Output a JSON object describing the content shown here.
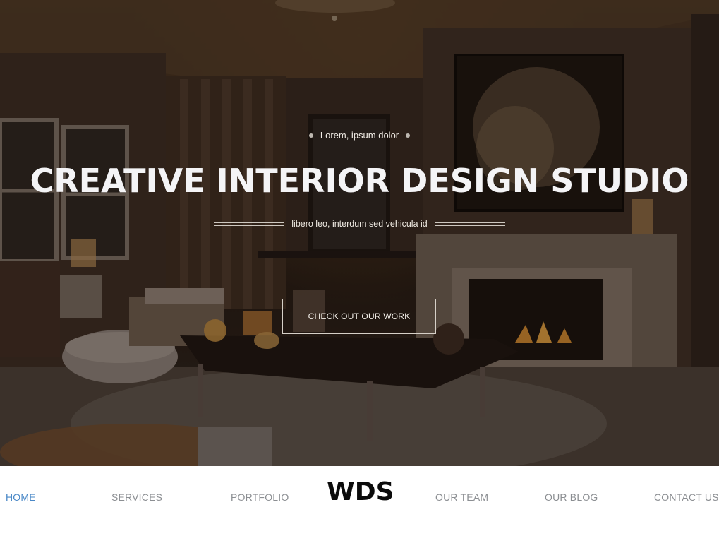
{
  "hero": {
    "eyebrow": "Lorem, ipsum dolor",
    "title": "CREATIVE INTERIOR DESIGN STUDIO",
    "tagline": "libero leo, interdum sed vehicula id",
    "cta_label": "CHECK OUT OUR WORK"
  },
  "nav": {
    "logo": "WDS",
    "items": [
      {
        "label": "HOME",
        "active": true
      },
      {
        "label": "SERVICES"
      },
      {
        "label": "PORTFOLIO"
      },
      {
        "label": "OUR TEAM"
      },
      {
        "label": "OUR BLOG"
      },
      {
        "label": "CONTACT US"
      }
    ]
  },
  "colors": {
    "nav_active": "#4a88c7",
    "nav_text": "#8b8e92",
    "logo": "#0b0b0b",
    "hero_text": "#f4f4f6"
  }
}
